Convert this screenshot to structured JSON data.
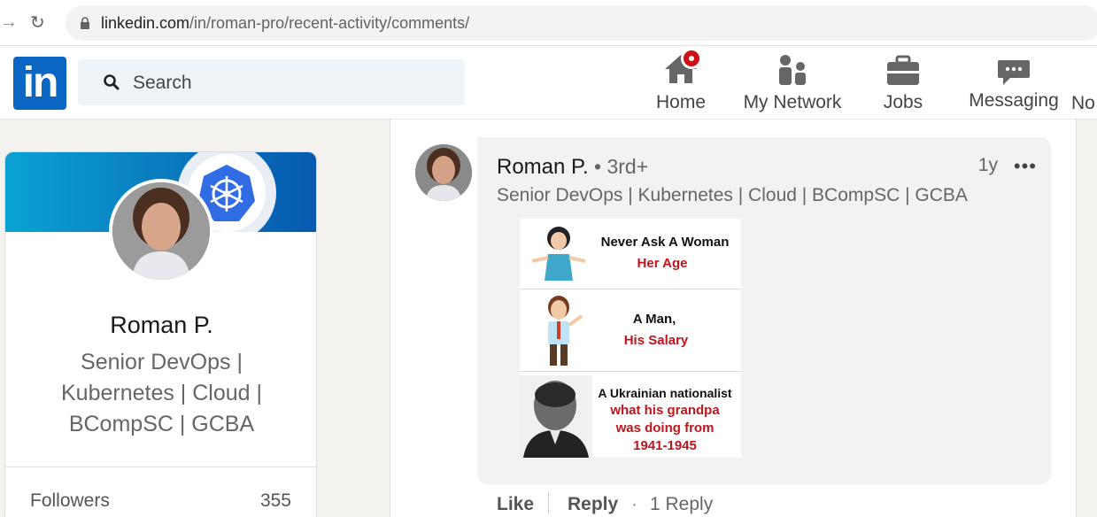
{
  "browser": {
    "url_host": "linkedin.com",
    "url_path": "/in/roman-pro/recent-activity/comments/"
  },
  "header": {
    "logo_text": "in",
    "search_placeholder": "Search",
    "nav": {
      "home": "Home",
      "network": "My Network",
      "jobs": "Jobs",
      "messaging": "Messaging",
      "notifications": "No"
    }
  },
  "profile": {
    "name": "Roman P.",
    "headline": "Senior DevOps | Kubernetes | Cloud | BCompSC | GCBA",
    "followers_label": "Followers",
    "followers_count": "355"
  },
  "comment": {
    "author": "Roman P.",
    "degree": " • 3rd+",
    "time": "1y",
    "more": "•••",
    "headline": "Senior DevOps | Kubernetes | Cloud | BCompSC | GCBA",
    "meme": {
      "panel1_line1": "Never Ask A Woman",
      "panel1_line2": "Her Age",
      "panel2_line1": "A Man,",
      "panel2_line2": "His Salary",
      "panel3_line1": "A Ukrainian nationalist",
      "panel3_line2": "what his grandpa",
      "panel3_line3": "was doing from",
      "panel3_line4": "1941-1945"
    },
    "actions": {
      "like": "Like",
      "reply": "Reply",
      "dot": "·",
      "replies": "1 Reply"
    }
  },
  "colors": {
    "linkedin_blue": "#0a66c2",
    "notification_red": "#cc1016"
  }
}
